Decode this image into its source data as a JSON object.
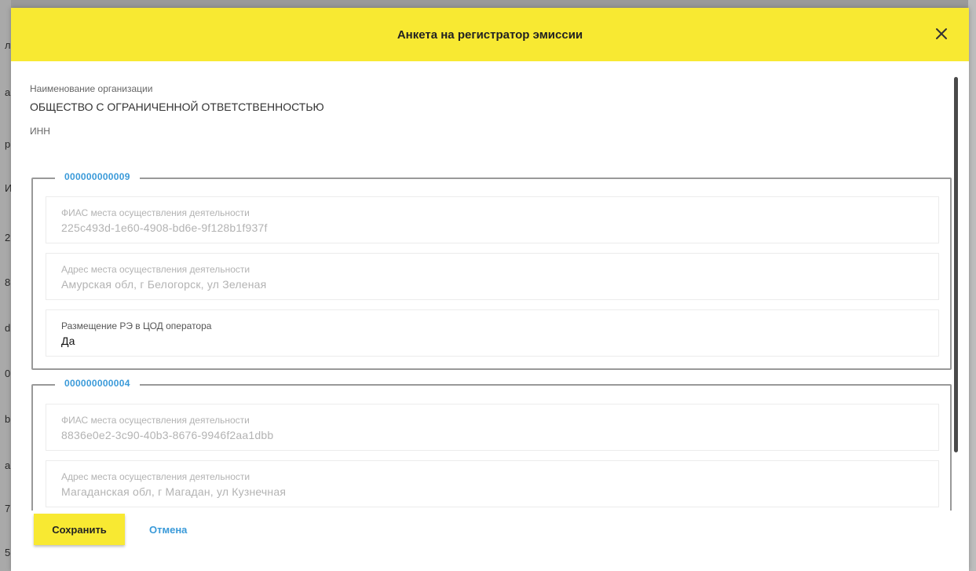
{
  "background": {
    "left_glyphs": [
      "л",
      "а",
      "р",
      "И",
      "2",
      "8",
      "d",
      "0",
      "b",
      "a",
      "7",
      "5"
    ]
  },
  "modal": {
    "title": "Анкета на регистратор эмиссии",
    "close_icon": "close-icon",
    "org_label": "Наименование организации",
    "org_value": "ОБЩЕСТВО С ОГРАНИЧЕННОЙ ОТВЕТСТВЕННОСТЬЮ",
    "inn_label": "ИНН",
    "groups": [
      {
        "code": "000000000009",
        "fias_label": "ФИАС места осуществления деятельности",
        "fias_value": "225c493d-1e60-4908-bd6e-9f128b1f937f",
        "address_label": "Адрес места осуществления деятельности",
        "address_value": "Амурская обл, г Белогорск, ул Зеленая",
        "placement_label": "Размещение РЭ в ЦОД оператора",
        "placement_value": "Да"
      },
      {
        "code": "000000000004",
        "fias_label": "ФИАС места осуществления деятельности",
        "fias_value": "8836e0e2-3c90-40b3-8676-9946f2aa1dbb",
        "address_label": "Адрес места осуществления деятельности",
        "address_value": "Магаданская обл, г Магадан, ул Кузнечная"
      }
    ],
    "save_label": "Сохранить",
    "cancel_label": "Отмена"
  },
  "colors": {
    "accent_yellow": "#f8e932",
    "link_blue": "#3a9ad9"
  }
}
